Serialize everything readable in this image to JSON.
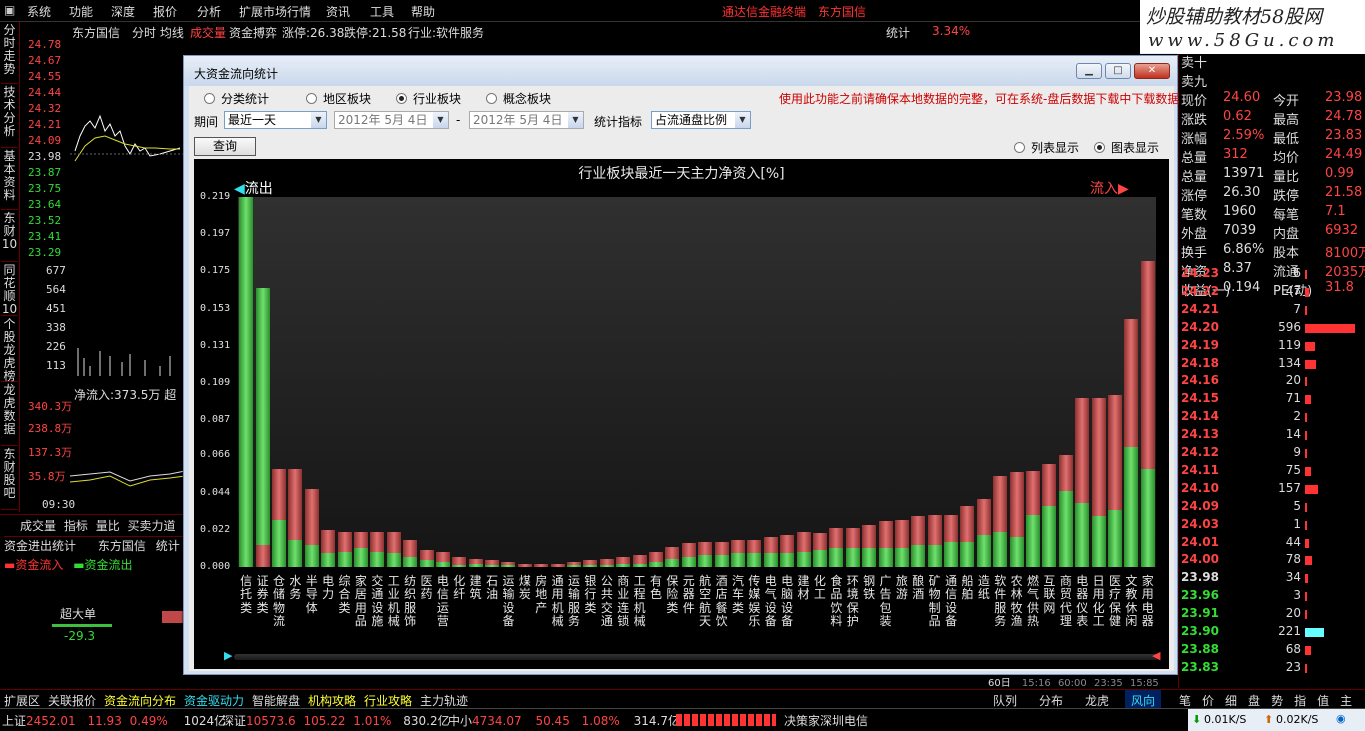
{
  "menu": [
    "系统",
    "功能",
    "深度",
    "报价",
    "分析",
    "扩展市场行情",
    "资讯",
    "工具",
    "帮助"
  ],
  "menu_right": {
    "a": "通达信金融终端",
    "b": "东方国信"
  },
  "watermark": {
    "line1": "炒股辅助教材58股网",
    "line2": "www.58Gu.com"
  },
  "left_nav": [
    "分时走势",
    "技术分析",
    "基本资料",
    "东财10",
    "同花顺10",
    "个股龙虎榜",
    "龙虎数据",
    "东财股吧"
  ],
  "stock_header": {
    "name": "东方国信",
    "tabs": "分时 均线",
    "vol_label": "成交量",
    "capital": "资金搏弈",
    "limit_up": "涨停:26.38",
    "limit_down": "跌停:21.58",
    "industry": "行业:软件服务",
    "stats": "统计",
    "pct": "3.34%"
  },
  "price_axis": [
    "24.78",
    "24.67",
    "24.55",
    "24.44",
    "24.32",
    "24.21",
    "24.09",
    "23.98",
    "23.87",
    "23.75",
    "23.64",
    "23.52",
    "23.41",
    "23.29"
  ],
  "vol_axis": [
    "677",
    "564",
    "451",
    "338",
    "226",
    "113"
  ],
  "flow_axis": [
    "340.3万",
    "238.8万",
    "137.3万",
    "35.8万",
    "09:30"
  ],
  "net_inflow": "净流入:373.5万",
  "net_inflow_extra": "超",
  "lower_tabs": [
    "成交量",
    "指标",
    "量比",
    "买卖力道"
  ],
  "flow_panel": {
    "title": "资金进出统计",
    "name": "东方国信",
    "stat": "统计",
    "legend_in": "资金流入",
    "legend_out": "资金流出",
    "big": "超大单",
    "big_val": "-29.3"
  },
  "right_info": [
    [
      "卖十",
      ""
    ],
    [
      "卖九",
      ""
    ],
    [
      "现价",
      "24.60",
      "今开",
      "23.98"
    ],
    [
      "涨跌",
      "0.62",
      "最高",
      "24.78"
    ],
    [
      "涨幅",
      "2.59%",
      "最低",
      "23.83"
    ],
    [
      "总量",
      "312",
      "均价",
      "24.49"
    ],
    [
      "总量",
      "13971",
      "量比",
      "0.99"
    ],
    [
      "涨停",
      "26.30",
      "跌停",
      "21.58"
    ],
    [
      "笔数",
      "1960",
      "每笔",
      "7.1"
    ],
    [
      "外盘",
      "7039",
      "内盘",
      "6932"
    ],
    [
      "换手",
      "6.86%",
      "股本",
      "8100万"
    ],
    [
      "净资",
      "8.37",
      "流通",
      "2035万"
    ],
    [
      "收益(一)",
      "0.194",
      "PE(动)",
      "31.8"
    ]
  ],
  "book": [
    [
      "24.23",
      "6"
    ],
    [
      "24.22",
      "47"
    ],
    [
      "24.21",
      "7"
    ],
    [
      "24.20",
      "596"
    ],
    [
      "24.19",
      "119"
    ],
    [
      "24.18",
      "134"
    ],
    [
      "24.16",
      "20"
    ],
    [
      "24.15",
      "71"
    ],
    [
      "24.14",
      "2"
    ],
    [
      "24.13",
      "14"
    ],
    [
      "24.12",
      "9"
    ],
    [
      "24.11",
      "75"
    ],
    [
      "24.10",
      "157"
    ],
    [
      "24.09",
      "5"
    ],
    [
      "24.03",
      "1"
    ],
    [
      "24.01",
      "44"
    ],
    [
      "24.00",
      "78"
    ],
    [
      "23.98",
      "34"
    ],
    [
      "23.96",
      "3"
    ],
    [
      "23.91",
      "20"
    ],
    [
      "23.90",
      "221"
    ],
    [
      "23.88",
      "68"
    ],
    [
      "23.83",
      "23"
    ]
  ],
  "dialog": {
    "title": "大资金流向统计",
    "radios": [
      "分类统计",
      "地区板块",
      "行业板块",
      "概念板块"
    ],
    "selected_radio": "行业板块",
    "warning": "使用此功能之前请确保本地数据的完整，可在系统-盘后数据下载中下载数据",
    "period_label": "期间",
    "period_value": "最近一天",
    "date1": "2012年  5月  4日",
    "dash": "-",
    "date2": "2012年  5月  4日",
    "indicator_label": "统计指标",
    "indicator_value": "占流通盘比例",
    "query": "查询",
    "view_list": "列表显示",
    "view_chart": "图表显示"
  },
  "chart_data": {
    "type": "bar",
    "title": "行业板块最近一天主力净资入[%]",
    "left_label": "流出",
    "right_label": "流入",
    "y_ticks": [
      "0.000",
      "0.022",
      "0.044",
      "0.066",
      "0.087",
      "0.109",
      "0.131",
      "0.153",
      "0.175",
      "0.197",
      "0.219"
    ],
    "ylim": [
      0,
      0.219
    ],
    "series": [
      {
        "name": "流出",
        "color": "#3fbf3f"
      },
      {
        "name": "流入",
        "color": "#c04848"
      }
    ],
    "categories": [
      "信托类",
      "证券类",
      "仓储物流",
      "水务",
      "半导体",
      "电力",
      "综合类",
      "家居用品",
      "交通设施",
      "工业机械",
      "纺织服饰",
      "医药",
      "电信运营",
      "化纤",
      "建筑",
      "石油",
      "运输设备",
      "煤炭",
      "房地产",
      "通用机械",
      "运输服务",
      "银行类",
      "公共交通",
      "商业连锁",
      "工程机械",
      "有色",
      "保险类",
      "元器件",
      "航空航天",
      "酒店餐饮",
      "汽车类",
      "传媒娱乐",
      "电气设备",
      "电脑设备",
      "建材",
      "化工",
      "食品饮料",
      "环境保护",
      "钢铁",
      "广告包装",
      "旅游",
      "酿酒",
      "矿物制品",
      "通信设备",
      "船舶",
      "造纸",
      "软件服务",
      "农林牧渔",
      "燃气供热",
      "互联网",
      "商贸代理",
      "电器仪表",
      "日用化工",
      "医疗保健",
      "文教休闲",
      "家用电器"
    ],
    "outflow": [
      0.219,
      0.165,
      0.028,
      0.016,
      0.013,
      0.008,
      0.009,
      0.011,
      0.009,
      0.008,
      0.006,
      0.004,
      0.003,
      0.001,
      0.002,
      0.001,
      0.001,
      0.0,
      0.0,
      0.0,
      0.001,
      0.001,
      0.001,
      0.002,
      0.002,
      0.003,
      0.005,
      0.006,
      0.007,
      0.007,
      0.008,
      0.008,
      0.008,
      0.008,
      0.009,
      0.01,
      0.011,
      0.011,
      0.011,
      0.011,
      0.011,
      0.013,
      0.013,
      0.015,
      0.015,
      0.019,
      0.021,
      0.018,
      0.031,
      0.036,
      0.045,
      0.038,
      0.03,
      0.034,
      0.071,
      0.058
    ],
    "inflow": [
      0.0,
      0.013,
      0.058,
      0.058,
      0.046,
      0.022,
      0.021,
      0.021,
      0.021,
      0.021,
      0.016,
      0.01,
      0.009,
      0.006,
      0.005,
      0.004,
      0.003,
      0.002,
      0.002,
      0.002,
      0.003,
      0.004,
      0.005,
      0.006,
      0.007,
      0.009,
      0.012,
      0.014,
      0.015,
      0.015,
      0.016,
      0.016,
      0.018,
      0.019,
      0.021,
      0.02,
      0.023,
      0.023,
      0.025,
      0.027,
      0.028,
      0.03,
      0.031,
      0.031,
      0.036,
      0.04,
      0.054,
      0.056,
      0.057,
      0.061,
      0.066,
      0.1,
      0.1,
      0.102,
      0.147,
      0.181
    ]
  },
  "bottom_tabs": [
    "扩展区",
    "关联报价",
    "资金流向分布",
    "资金驱动力",
    "智能解盘",
    "机构攻略",
    "行业攻略",
    "主力轨迹"
  ],
  "right_tabs": [
    "队列",
    "分布",
    "龙虎",
    "风向"
  ],
  "right_tabs2": [
    "笔",
    "价",
    "细",
    "盘",
    "势",
    "指",
    "值",
    "主"
  ],
  "time_axis": [
    "60日",
    "15:16",
    "60:00",
    "23:35",
    "15:85"
  ],
  "status": {
    "sh_label": "上证",
    "sh_val": "2452.01",
    "sh_chg": "11.93",
    "sh_pct": "0.49%",
    "sh_amt": "1024亿",
    "sz_label": "深证",
    "sz_val": "10573.6",
    "sz_chg": "105.22",
    "sz_pct": "1.01%",
    "sz_amt": "830.2亿",
    "zx_label": "中小",
    "zx_val": "4734.07",
    "zx_chg": "50.45",
    "zx_pct": "1.08%",
    "zx_amt": "314.7亿",
    "ticker": "决策家深圳电信",
    "down": "0.01K/S",
    "up": "0.02K/S"
  }
}
